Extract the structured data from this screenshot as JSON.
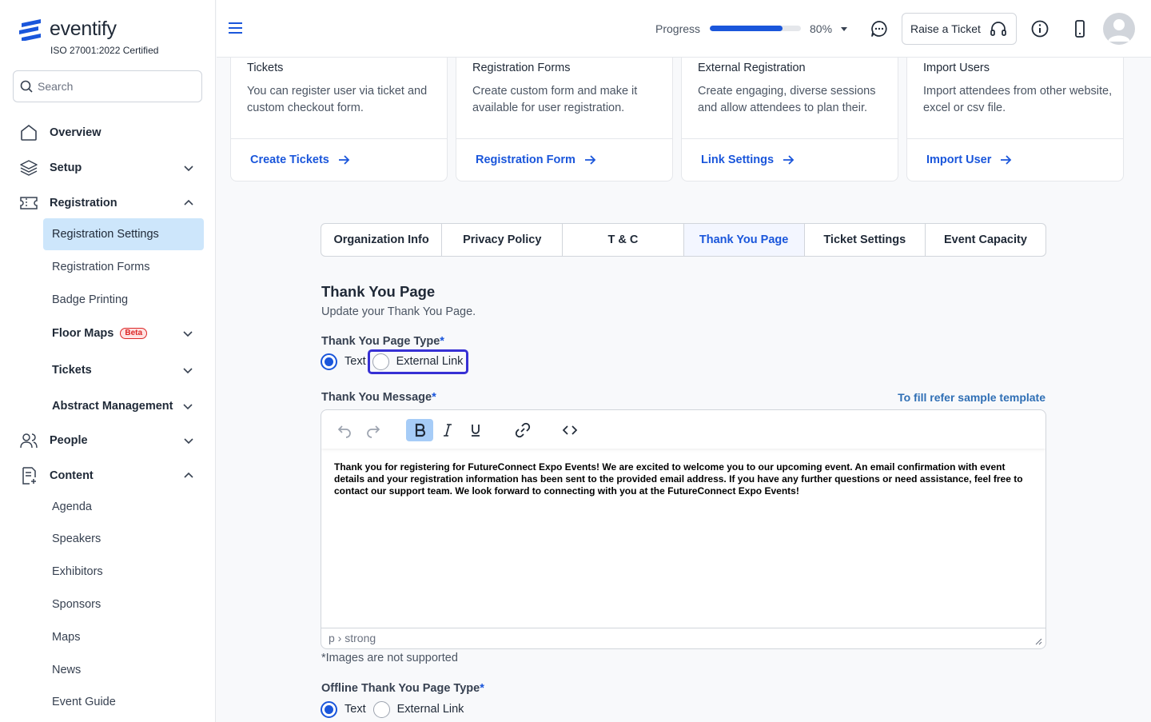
{
  "brand": {
    "name": "eventify",
    "iso": "ISO 27001:2022 Certified",
    "color": "#1a56db"
  },
  "search": {
    "placeholder": "Search"
  },
  "nav": {
    "overview": "Overview",
    "setup": "Setup",
    "registration": "Registration",
    "registration_items": [
      "Registration Settings",
      "Registration Forms",
      "Badge Printing"
    ],
    "floor_maps": "Floor Maps",
    "beta": "Beta",
    "tickets": "Tickets",
    "abstract": "Abstract Management",
    "people": "People",
    "content": "Content",
    "content_items": [
      "Agenda",
      "Speakers",
      "Exhibitors",
      "Sponsors",
      "Maps",
      "News",
      "Event Guide"
    ]
  },
  "header": {
    "progress_label": "Progress",
    "progress_value": 80,
    "progress_text": "80%",
    "raise_ticket": "Raise a Ticket"
  },
  "cards": [
    {
      "title": "Tickets",
      "desc": "You can register user via ticket and custom checkout form.",
      "link": "Create Tickets"
    },
    {
      "title": "Registration Forms",
      "desc": "Create custom form and make it available for user registration.",
      "link": "Registration Form"
    },
    {
      "title": "External Registration",
      "desc": "Create engaging, diverse sessions and allow attendees to plan their.",
      "link": "Link Settings"
    },
    {
      "title": "Import Users",
      "desc": "Import attendees from other website, excel or csv file.",
      "link": "Import User"
    }
  ],
  "tabs": [
    "Organization Info",
    "Privacy Policy",
    "T & C",
    "Thank You Page",
    "Ticket Settings",
    "Event Capacity"
  ],
  "active_tab": "Thank You Page",
  "section": {
    "title": "Thank You Page",
    "subtitle": "Update your Thank You Page.",
    "type_label": "Thank You Page Type",
    "required_mark": "*",
    "radio_text": "Text",
    "radio_external": "External Link",
    "message_label": "Thank You Message",
    "sample_link": "To fill refer sample template",
    "message": "Thank you for registering for FutureConnect Expo Events! We are excited to welcome you to our upcoming event. An email confirmation with event details and your registration information has been sent to the provided email address. If you have any further questions or need assistance, feel free to contact our support team. We look forward to connecting with you at the FutureConnect Expo Events!",
    "statusbar": "p › strong",
    "note": "*Images are not supported",
    "offline_label": "Offline Thank You Page Type"
  }
}
